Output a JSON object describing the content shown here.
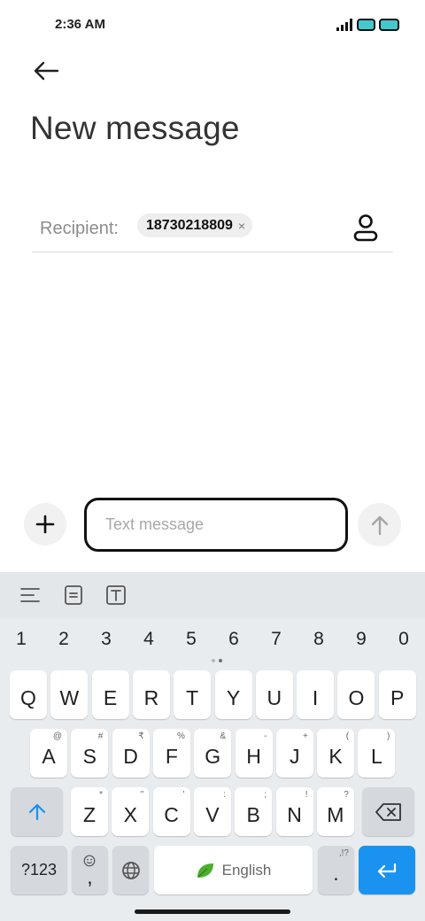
{
  "status_bar": {
    "time": "2:36 AM"
  },
  "header": {
    "title": "New message"
  },
  "recipient": {
    "label": "Recipient:",
    "chip": "18730218809",
    "chip_remove": "×"
  },
  "composer": {
    "placeholder": "Text message",
    "value": ""
  },
  "keyboard": {
    "toolbar_icons": [
      "menu-lines-icon",
      "document-icon",
      "text-format-icon"
    ],
    "numbers": [
      "1",
      "2",
      "3",
      "4",
      "5",
      "6",
      "7",
      "8",
      "9",
      "0"
    ],
    "row1": [
      {
        "key": "Q",
        "hint": ""
      },
      {
        "key": "W",
        "hint": ""
      },
      {
        "key": "E",
        "hint": ""
      },
      {
        "key": "R",
        "hint": ""
      },
      {
        "key": "T",
        "hint": ""
      },
      {
        "key": "Y",
        "hint": ""
      },
      {
        "key": "U",
        "hint": ""
      },
      {
        "key": "I",
        "hint": ""
      },
      {
        "key": "O",
        "hint": ""
      },
      {
        "key": "P",
        "hint": ""
      }
    ],
    "row2": [
      {
        "key": "A",
        "hint": "@"
      },
      {
        "key": "S",
        "hint": "#"
      },
      {
        "key": "D",
        "hint": "₹"
      },
      {
        "key": "F",
        "hint": "%"
      },
      {
        "key": "G",
        "hint": "&"
      },
      {
        "key": "H",
        "hint": "-"
      },
      {
        "key": "J",
        "hint": "+"
      },
      {
        "key": "K",
        "hint": "("
      },
      {
        "key": "L",
        "hint": ")"
      }
    ],
    "row3": [
      {
        "key": "Z",
        "hint": "*"
      },
      {
        "key": "X",
        "hint": "\""
      },
      {
        "key": "C",
        "hint": "'"
      },
      {
        "key": "V",
        "hint": ":"
      },
      {
        "key": "B",
        "hint": ";"
      },
      {
        "key": "N",
        "hint": "!"
      },
      {
        "key": "M",
        "hint": "?"
      }
    ],
    "symbols_key": "?123",
    "comma_key": ",",
    "period_key": ".",
    "period_hint": ",!?",
    "space_label": "English"
  },
  "colors": {
    "accent": "#1a93f0",
    "battery": "#45c8cc",
    "leaf": "#4caf2e"
  }
}
